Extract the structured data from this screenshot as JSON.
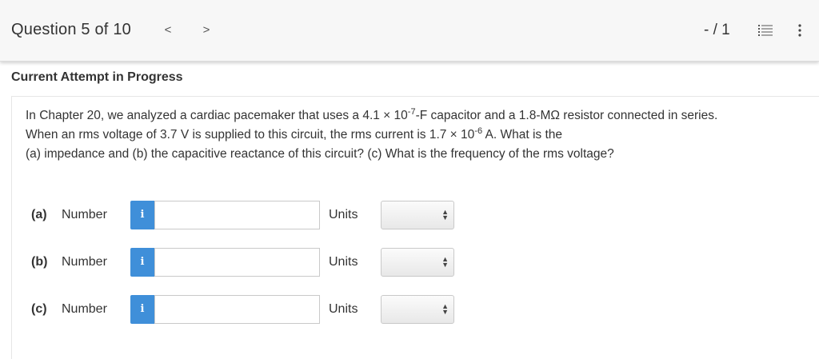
{
  "header": {
    "question_position": "Question 5 of 10",
    "prev_label": "<",
    "next_label": ">",
    "score": "- / 1"
  },
  "attempt_heading": "Current Attempt in Progress",
  "question": {
    "line1_before": "In Chapter 20, we analyzed a cardiac pacemaker that uses a 4.1 × 10",
    "line1_exp": "-7",
    "line1_after": "-F capacitor and a 1.8-MΩ resistor connected in series.",
    "line2_before": "When an rms voltage of 3.7 V is supplied to this circuit, the rms current is 1.7 × 10",
    "line2_exp": "-6",
    "line2_after": " A. What is the",
    "line3": "(a) impedance and (b) the capacitive reactance of this circuit? (c) What is the frequency of the rms voltage?"
  },
  "answers": [
    {
      "part": "(a)",
      "number_label": "Number",
      "info": "i",
      "value": "",
      "units_label": "Units",
      "units_selected": ""
    },
    {
      "part": "(b)",
      "number_label": "Number",
      "info": "i",
      "value": "",
      "units_label": "Units",
      "units_selected": ""
    },
    {
      "part": "(c)",
      "number_label": "Number",
      "info": "i",
      "value": "",
      "units_label": "Units",
      "units_selected": ""
    }
  ],
  "colors": {
    "info_button": "#3f8fd9",
    "header_bg": "#f7f7f7"
  },
  "icons": {
    "list": "list-icon",
    "more": "more-vertical-icon",
    "select_arrows": "up-down-arrows-icon"
  }
}
